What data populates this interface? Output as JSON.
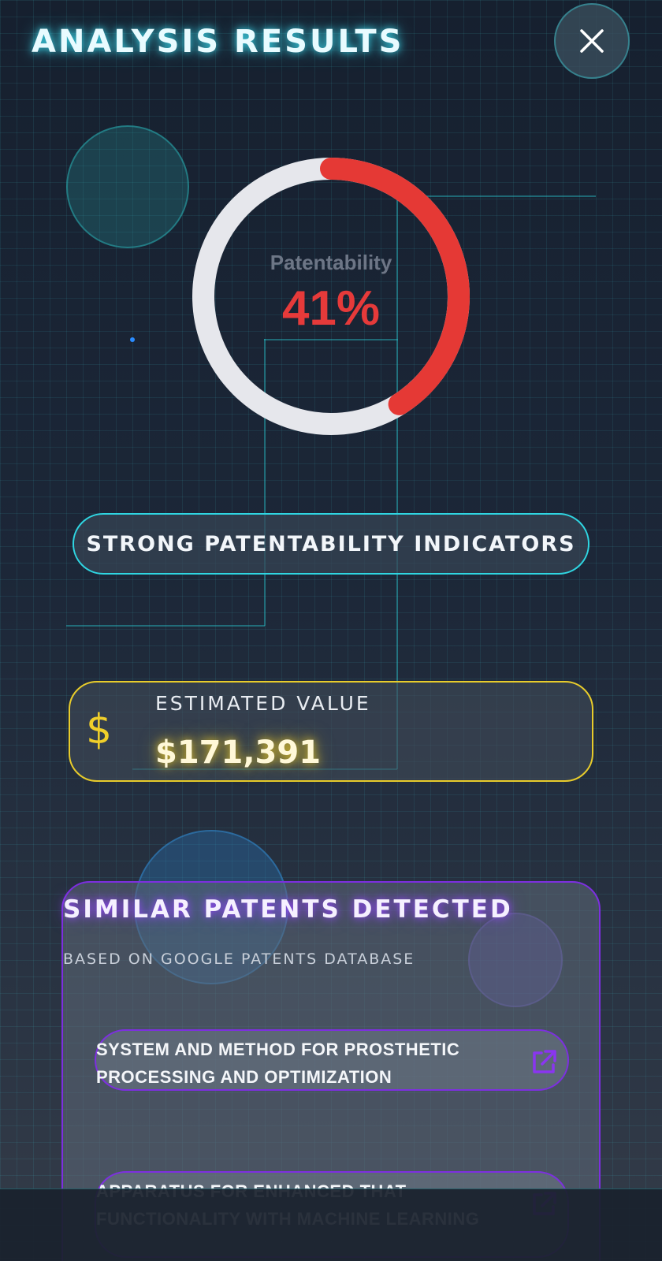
{
  "header": {
    "title": "ANALYSIS RESULTS"
  },
  "gauge": {
    "label": "Patentability",
    "value_text": "41%",
    "value": 41,
    "accent_color": "#e53935",
    "track_color": "#e6e7ec"
  },
  "indicator": {
    "label": "STRONG PATENTABILITY INDICATORS"
  },
  "estimate": {
    "label": "ESTIMATED VALUE",
    "amount": "$171,391",
    "icon": "dollar-icon"
  },
  "similar": {
    "title": "SIMILAR PATENTS DETECTED",
    "subtitle": "BASED ON GOOGLE PATENTS DATABASE",
    "patents": [
      {
        "title": "SYSTEM AND METHOD FOR PROSTHETIC PROCESSING AND OPTIMIZATION",
        "icon": "external-link-icon"
      },
      {
        "title": "APPARATUS FOR ENHANCED THAT FUNCTIONALITY WITH MACHINE LEARNING",
        "icon": "external-link-icon"
      }
    ]
  },
  "colors": {
    "cyan_accent": "#2fd6e2",
    "yellow_accent": "#e8cc2b",
    "purple_accent": "#7d2fe0"
  }
}
